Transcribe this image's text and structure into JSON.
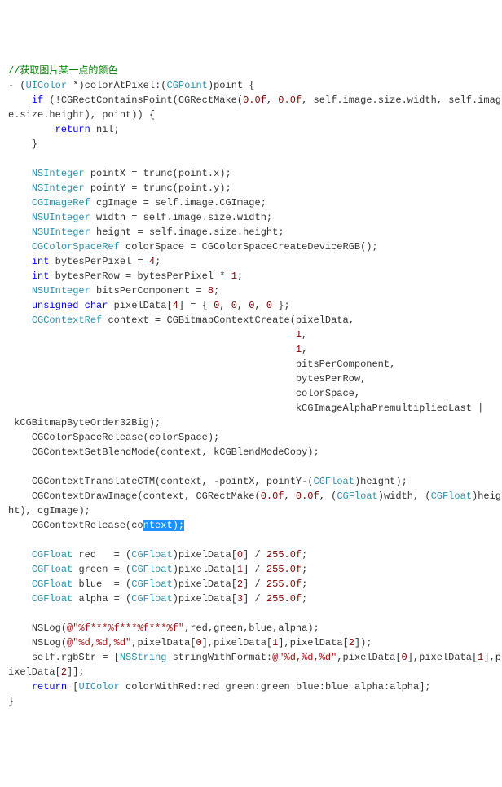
{
  "comment": "//获取图片某一点的颜色",
  "kw": {
    "if": "if",
    "return": "return",
    "int": "int",
    "unsigned": "unsigned",
    "char": "char"
  },
  "ty": {
    "UIColor": "UIColor",
    "CGPoint": "CGPoint",
    "NSInteger": "NSInteger",
    "NSUInteger": "NSUInteger",
    "CGImageRef": "CGImageRef",
    "CGColorSpaceRef": "CGColorSpaceRef",
    "CGContextRef": "CGContextRef",
    "CGFloat": "CGFloat",
    "NSString": "NSString"
  },
  "id": {
    "colorAtPixel": "colorAtPixel",
    "point": "point",
    "CGRectContainsPoint": "CGRectContainsPoint",
    "CGRectMake": "CGRectMake",
    "self": "self",
    "image": "image",
    "size": "size",
    "width": "width",
    "height": "height",
    "nil": "nil",
    "pointX": "pointX",
    "pointY": "pointY",
    "trunc": "trunc",
    "x": "x",
    "y": "y",
    "cgImage": "cgImage",
    "CGImage": "CGImage",
    "colorSpace": "colorSpace",
    "CGColorSpaceCreateDeviceRGB": "CGColorSpaceCreateDeviceRGB",
    "bytesPerPixel": "bytesPerPixel",
    "bytesPerRow": "bytesPerRow",
    "bitsPerComponent": "bitsPerComponent",
    "pixelData": "pixelData",
    "context": "context",
    "CGBitmapContextCreate": "CGBitmapContextCreate",
    "kCGImageAlphaPremultipliedLast": "kCGImageAlphaPremultipliedLast",
    "kCGBitmapByteOrder32Big": "kCGBitmapByteOrder32Big",
    "CGColorSpaceRelease": "CGColorSpaceRelease",
    "CGContextSetBlendMode": "CGContextSetBlendMode",
    "kCGBlendModeCopy": "kCGBlendModeCopy",
    "CGContextTranslateCTM": "CGContextTranslateCTM",
    "CGContextDrawImage": "CGContextDrawImage",
    "CGContextRelease": "CGContextRelease",
    "red": "red",
    "green": "green",
    "blue": "blue",
    "alpha": "alpha",
    "NSLog": "NSLog",
    "rgbStr": "rgbStr",
    "stringWithFormat": "stringWithFormat",
    "colorWithRed": "colorWithRed"
  },
  "num": {
    "n0f": "0.0f",
    "n1": "1",
    "n2": "2",
    "n3": "3",
    "n4": "4",
    "n8": "8",
    "n0": "0",
    "n255f": "255.0f"
  },
  "str": {
    "fmt1": "@\"%f***%f***%f***%f\"",
    "fmt2": "@\"%d,%d,%d\""
  },
  "sel": "ntext);"
}
